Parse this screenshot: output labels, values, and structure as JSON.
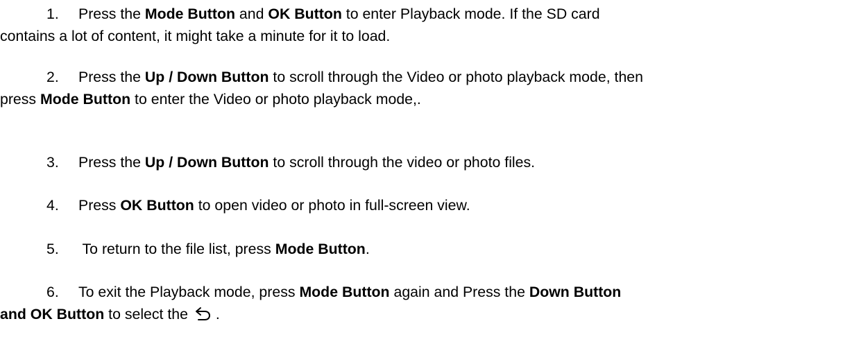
{
  "steps": [
    {
      "num": "1.",
      "lines": [
        [
          {
            "t": "Press the ",
            "b": false
          },
          {
            "t": "Mode Button",
            "b": true
          },
          {
            "t": " and ",
            "b": false
          },
          {
            "t": "OK Button",
            "b": true
          },
          {
            "t": " to enter Playback mode. If the SD card",
            "b": false
          }
        ],
        [
          {
            "t": "contains a lot of content, it might take a minute for it to load.",
            "b": false
          }
        ]
      ]
    },
    {
      "num": "2.",
      "lines": [
        [
          {
            "t": "Press the ",
            "b": false
          },
          {
            "t": "Up / Down Button",
            "b": true
          },
          {
            "t": " to scroll through the Video or photo playback mode, then",
            "b": false
          }
        ],
        [
          {
            "t": "press ",
            "b": false
          },
          {
            "t": "Mode Button",
            "b": true
          },
          {
            "t": " to enter the Video or photo playback mode,.",
            "b": false
          }
        ]
      ]
    },
    {
      "num": "3.",
      "lines": [
        [
          {
            "t": "Press the ",
            "b": false
          },
          {
            "t": "Up / Down Button",
            "b": true
          },
          {
            "t": " to scroll through the video or photo files.",
            "b": false
          }
        ]
      ]
    },
    {
      "num": "4.",
      "lines": [
        [
          {
            "t": "Press ",
            "b": false
          },
          {
            "t": "OK Button",
            "b": true
          },
          {
            "t": " to open video or photo in full-screen view.",
            "b": false
          }
        ]
      ]
    },
    {
      "num": "5.",
      "lines": [
        [
          {
            "t": " To return to the file list, press ",
            "b": false
          },
          {
            "t": "Mode Button",
            "b": true
          },
          {
            "t": ".",
            "b": false
          }
        ]
      ]
    },
    {
      "num": "6.",
      "lines": [
        [
          {
            "t": "To exit the Playback mode, press ",
            "b": false
          },
          {
            "t": "Mode Button",
            "b": true
          },
          {
            "t": " again and Press the ",
            "b": false
          },
          {
            "t": "Down Button",
            "b": true
          }
        ],
        [
          {
            "t": "and OK Button",
            "b": true
          },
          {
            "t": " to select the ",
            "b": false
          },
          {
            "icon": "return-arrow-icon"
          },
          {
            "t": " .",
            "b": false
          }
        ]
      ]
    }
  ]
}
